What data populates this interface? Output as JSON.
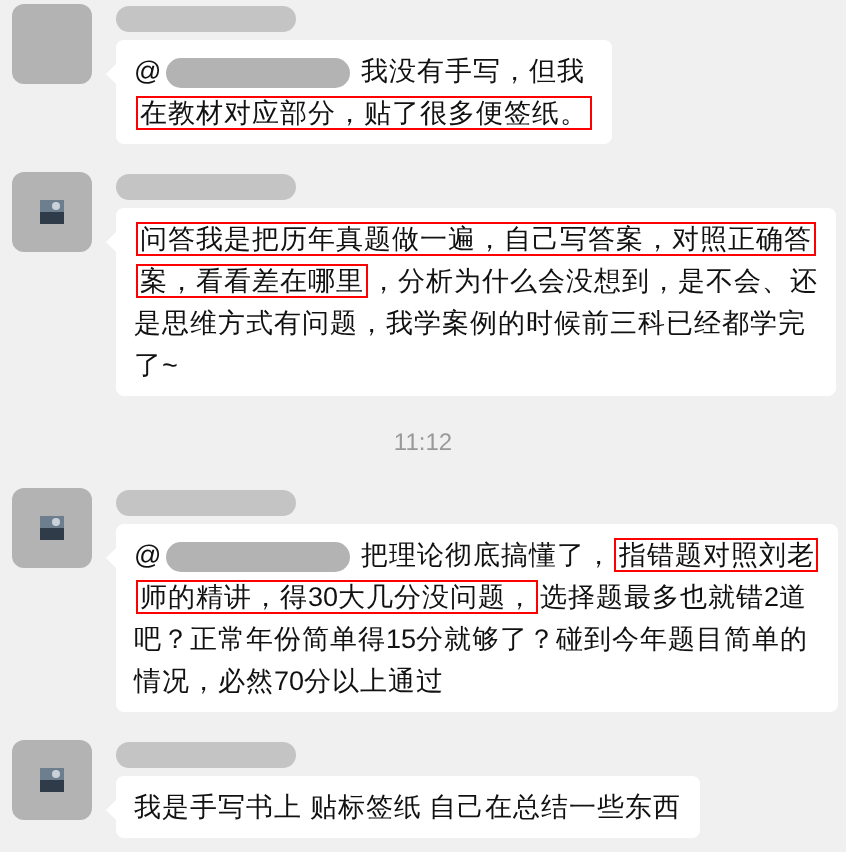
{
  "messages": [
    {
      "photo": false,
      "lines": [
        [
          {
            "kind": "text",
            "text": "@",
            "highlighted": false
          },
          {
            "kind": "redaction"
          },
          {
            "kind": "text",
            "text": " 我没有手写，但我",
            "highlighted": false
          }
        ],
        [
          {
            "kind": "text",
            "text": "在教材对应部分，贴了很多便签纸。",
            "highlighted": true
          }
        ]
      ]
    },
    {
      "photo": true,
      "lines": [
        [
          {
            "kind": "text",
            "text": "问答我是把历年真题做一遍，自己写答案，对照正确答",
            "highlighted": true
          }
        ],
        [
          {
            "kind": "text",
            "text": "案，看看差在哪里",
            "highlighted": true
          },
          {
            "kind": "text",
            "text": "，分析为什么会没想到，是不会、还",
            "highlighted": false
          }
        ],
        [
          {
            "kind": "text",
            "text": "是思维方式有问题，我学案例的时候前三科已经都学完",
            "highlighted": false
          }
        ],
        [
          {
            "kind": "text",
            "text": "了~",
            "highlighted": false
          }
        ]
      ]
    },
    {
      "kind": "time",
      "text": "11:12"
    },
    {
      "photo": true,
      "lines": [
        [
          {
            "kind": "text",
            "text": "@",
            "highlighted": false
          },
          {
            "kind": "redaction"
          },
          {
            "kind": "text",
            "text": " 把理论彻底搞懂了，",
            "highlighted": false
          },
          {
            "kind": "text",
            "text": "指错题对照刘老",
            "highlighted": true
          }
        ],
        [
          {
            "kind": "text",
            "text": "师的精讲，得30大几分没问题，",
            "highlighted": true
          },
          {
            "kind": "text",
            "text": "选择题最多也就错2道",
            "highlighted": false
          }
        ],
        [
          {
            "kind": "text",
            "text": "吧？正常年份简单得15分就够了？碰到今年题目简单的",
            "highlighted": false
          }
        ],
        [
          {
            "kind": "text",
            "text": "情况，必然70分以上通过",
            "highlighted": false
          }
        ]
      ]
    },
    {
      "photo": true,
      "lines": [
        [
          {
            "kind": "text",
            "text": "我是手写书上 贴标签纸 自己在总结一些东西",
            "highlighted": false
          }
        ]
      ]
    }
  ]
}
